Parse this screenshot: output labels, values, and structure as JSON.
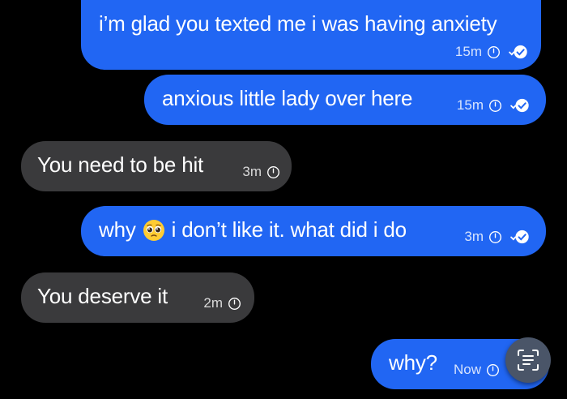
{
  "messages": [
    {
      "direction": "outgoing",
      "text": "i’m glad you texted me i was having anxiety",
      "time": "15m",
      "status": "read"
    },
    {
      "direction": "outgoing",
      "text": "anxious little lady over here",
      "time": "15m",
      "status": "read"
    },
    {
      "direction": "incoming",
      "text": "You need to be hit",
      "time": "3m"
    },
    {
      "direction": "outgoing",
      "text_before": "why",
      "emoji": "pleading-face-emoji",
      "text_after": "i don’t like it. what did i do",
      "time": "3m",
      "status": "read"
    },
    {
      "direction": "incoming",
      "text": "You deserve it",
      "time": "2m"
    },
    {
      "direction": "outgoing",
      "text": "why?",
      "time": "Now",
      "status": "sent"
    }
  ],
  "colors": {
    "outgoing_bubble": "#2166f3",
    "incoming_bubble": "#3a3a3c",
    "background": "#000000"
  },
  "icons": {
    "clock": "clock-icon",
    "read": "double-check-icon",
    "scan": "scan-text-icon"
  }
}
